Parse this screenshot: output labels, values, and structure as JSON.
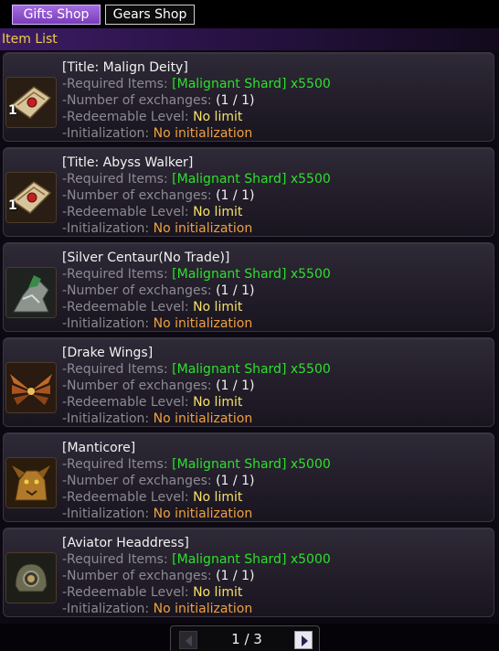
{
  "tabs": {
    "gifts": "Gifts Shop",
    "gears": "Gears Shop"
  },
  "list_title": "Item List",
  "labels": {
    "required": "-Required Items: ",
    "exchanges": "-Number of exchanges: ",
    "level": "-Redeemable Level: ",
    "init": "-Initialization: "
  },
  "items": [
    {
      "name": "[Title: Malign Deity]",
      "required": "[Malignant Shard] x5500",
      "exchanges": "(1 / 1)",
      "level": "No limit",
      "init": "No initialization",
      "count": "1",
      "icon": "title-scroll-icon"
    },
    {
      "name": "[Title: Abyss Walker]",
      "required": "[Malignant Shard] x5500",
      "exchanges": "(1 / 1)",
      "level": "No limit",
      "init": "No initialization",
      "count": "1",
      "icon": "title-scroll-icon"
    },
    {
      "name": "[Silver Centaur(No Trade)]",
      "required": "[Malignant Shard] x5500",
      "exchanges": "(1 / 1)",
      "level": "No limit",
      "init": "No initialization",
      "count": "",
      "icon": "centaur-icon"
    },
    {
      "name": "[Drake Wings]",
      "required": "[Malignant Shard] x5500",
      "exchanges": "(1 / 1)",
      "level": "No limit",
      "init": "No initialization",
      "count": "",
      "icon": "drake-wings-icon"
    },
    {
      "name": "[Manticore]",
      "required": "[Malignant Shard] x5000",
      "exchanges": "(1 / 1)",
      "level": "No limit",
      "init": "No initialization",
      "count": "",
      "icon": "manticore-icon"
    },
    {
      "name": "[Aviator Headdress]",
      "required": "[Malignant Shard] x5000",
      "exchanges": "(1 / 1)",
      "level": "No limit",
      "init": "No initialization",
      "count": "",
      "icon": "aviator-helmet-icon"
    }
  ],
  "pager": {
    "current": "1 / 3"
  },
  "colors": {
    "accent": "#7a3bbb",
    "header_text": "#f0cc46",
    "required_text": "#2ce02c",
    "level_text": "#f6e06a",
    "init_text": "#f0a040"
  }
}
